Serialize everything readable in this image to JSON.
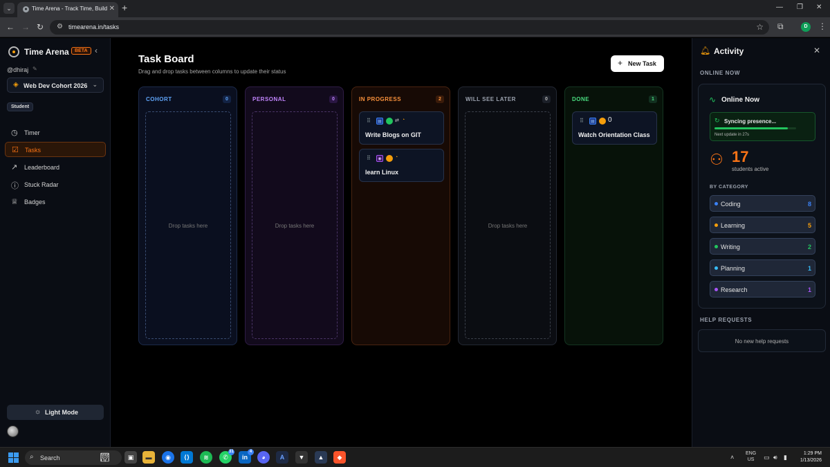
{
  "browser": {
    "tab_title": "Time Arena - Track Time, Build",
    "url": "timearena.in/tasks",
    "profile_initial": "D"
  },
  "sidebar": {
    "app_name": "Time Arena",
    "beta_badge": "BETA",
    "username": "@dhiraj",
    "cohort": "Web Dev Cohort 2026",
    "role": "Student",
    "nav": [
      {
        "label": "Timer",
        "icon": "clock-icon"
      },
      {
        "label": "Tasks",
        "icon": "tasks-icon",
        "active": true
      },
      {
        "label": "Leaderboard",
        "icon": "trend-icon"
      },
      {
        "label": "Stuck Radar",
        "icon": "help-circle-icon"
      },
      {
        "label": "Badges",
        "icon": "award-icon"
      }
    ],
    "mode_button": "Light Mode"
  },
  "board": {
    "title": "Task Board",
    "subtitle": "Drag and drop tasks between columns to update their status",
    "new_task": "New Task",
    "drop_placeholder": "Drop tasks here",
    "columns": [
      {
        "title": "COHORT",
        "count": "0",
        "color": "#60a5fa"
      },
      {
        "title": "PERSONAL",
        "count": "0",
        "color": "#c084fc"
      },
      {
        "title": "IN PROGRESS",
        "count": "2",
        "color": "#fb923c"
      },
      {
        "title": "WILL SEE LATER",
        "count": "0",
        "color": "#9ca3af"
      },
      {
        "title": "DONE",
        "count": "1",
        "color": "#4ade80"
      }
    ],
    "in_progress_cards": [
      {
        "title": "Write Blogs on GIT",
        "tag": "cohort",
        "status_color": "#22c55e"
      },
      {
        "title": "learn Linux",
        "tag": "personal",
        "status_color": "#f59e0b"
      }
    ],
    "done_cards": [
      {
        "title": "Watch Orientation Class",
        "tag": "cohort",
        "status_color": "#f59e0b",
        "count": "0"
      }
    ]
  },
  "activity": {
    "title": "Activity",
    "online_now_section": "ONLINE NOW",
    "online_now_title": "Online Now",
    "sync_text": "Syncing presence...",
    "sync_progress": 0.9,
    "next_update": "Next update in 27s",
    "students_count": "17",
    "students_label": "students active",
    "by_category": "BY CATEGORY",
    "categories": [
      {
        "label": "Coding",
        "count": "8",
        "color": "#3b82f6"
      },
      {
        "label": "Learning",
        "count": "5",
        "color": "#f59e0b"
      },
      {
        "label": "Writing",
        "count": "2",
        "color": "#22c55e"
      },
      {
        "label": "Planning",
        "count": "1",
        "color": "#38bdf8"
      },
      {
        "label": "Research",
        "count": "1",
        "color": "#a855f7"
      }
    ],
    "help_section": "HELP REQUESTS",
    "help_empty": "No new help requests"
  },
  "taskbar": {
    "search": "Search",
    "whatsapp_badge": "31",
    "linkedin_badge": "4",
    "lang_1": "ENG",
    "lang_2": "US",
    "time": "1:29 PM",
    "date": "1/13/2026"
  }
}
